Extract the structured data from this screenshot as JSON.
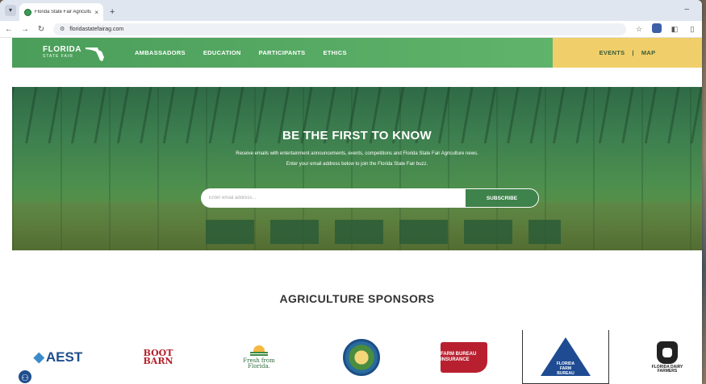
{
  "browser": {
    "tab_title": "Florida State Fair Agriculture | F",
    "tab_close": "×",
    "new_tab": "+",
    "url": "floridastatefairag.com",
    "tab_menu": "▾",
    "minimize": "–"
  },
  "header": {
    "logo_text": "FLORIDA",
    "logo_sub": "STATE FAIR",
    "nav": [
      "AMBASSADORS",
      "EDUCATION",
      "PARTICIPANTS",
      "ETHICS"
    ],
    "right_nav": [
      "EVENTS",
      "|",
      "MAP"
    ]
  },
  "hero": {
    "title": "BE THE FIRST TO KNOW",
    "line1": "Receive emails with entertainment announcements, events, competitions and Florida State Fair Agriculture news.",
    "line2": "Enter your email address below to join the Florida State Fair buzz.",
    "email_placeholder": "Enter email address...",
    "subscribe_label": "SUBSCRIBE"
  },
  "sponsors": {
    "title": "AGRICULTURE SPONSORS",
    "aest": "AEST",
    "boot_barn": "BOOT BARN",
    "fresh_from_florida": "Fresh from Florida.",
    "farm_bureau": "FARM BUREAU INSURANCE",
    "florida_farm_bureau": "FLORIDA FARM BUREAU",
    "dairy": "FLORIDA DAIRY FARMERS"
  },
  "colors": {
    "header_green": "#4a9e5a",
    "header_yellow": "#f0cf6a",
    "hero_green": "#3d7f4f"
  }
}
